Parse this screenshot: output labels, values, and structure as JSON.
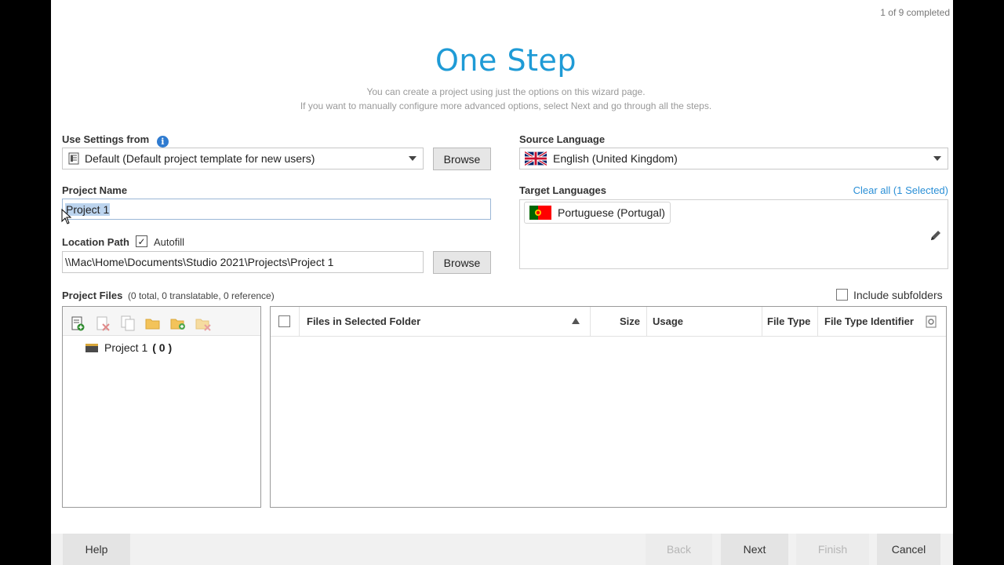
{
  "progress_text": "1 of 9 completed",
  "title": "One Step",
  "subtitle_lines": [
    "You can create a project using just the options on this wizard page.",
    "If you want to manually configure more advanced options, select Next and go through all the steps."
  ],
  "use_settings": {
    "label": "Use Settings from",
    "value": "Default (Default project template for new users)",
    "browse_label": "Browse"
  },
  "source_language": {
    "label": "Source Language",
    "value": "English (United Kingdom)"
  },
  "project_name": {
    "label": "Project Name",
    "value": "Project 1"
  },
  "target_languages": {
    "label": "Target Languages",
    "clear_link": "Clear all (1 Selected)",
    "items": [
      "Portuguese (Portugal)"
    ]
  },
  "location": {
    "label": "Location Path",
    "autofill_label": "Autofill",
    "autofill_checked": true,
    "value": "\\\\Mac\\Home\\Documents\\Studio 2021\\Projects\\Project 1",
    "browse_label": "Browse"
  },
  "project_files": {
    "label": "Project Files",
    "summary": "(0 total, 0 translatable, 0 reference)",
    "include_subfolders_label": "Include subfolders",
    "include_subfolders_checked": false,
    "tree_item": "Project 1",
    "tree_count": "( 0 )",
    "columns": [
      "Files in Selected Folder",
      "Size",
      "Usage",
      "File Type",
      "File Type Identifier"
    ]
  },
  "footer": {
    "help": "Help",
    "back": "Back",
    "next": "Next",
    "finish": "Finish",
    "cancel": "Cancel"
  },
  "colors": {
    "accent": "#1f9bd6",
    "link": "#2a8fd6",
    "selection": "#bcd4ee"
  }
}
